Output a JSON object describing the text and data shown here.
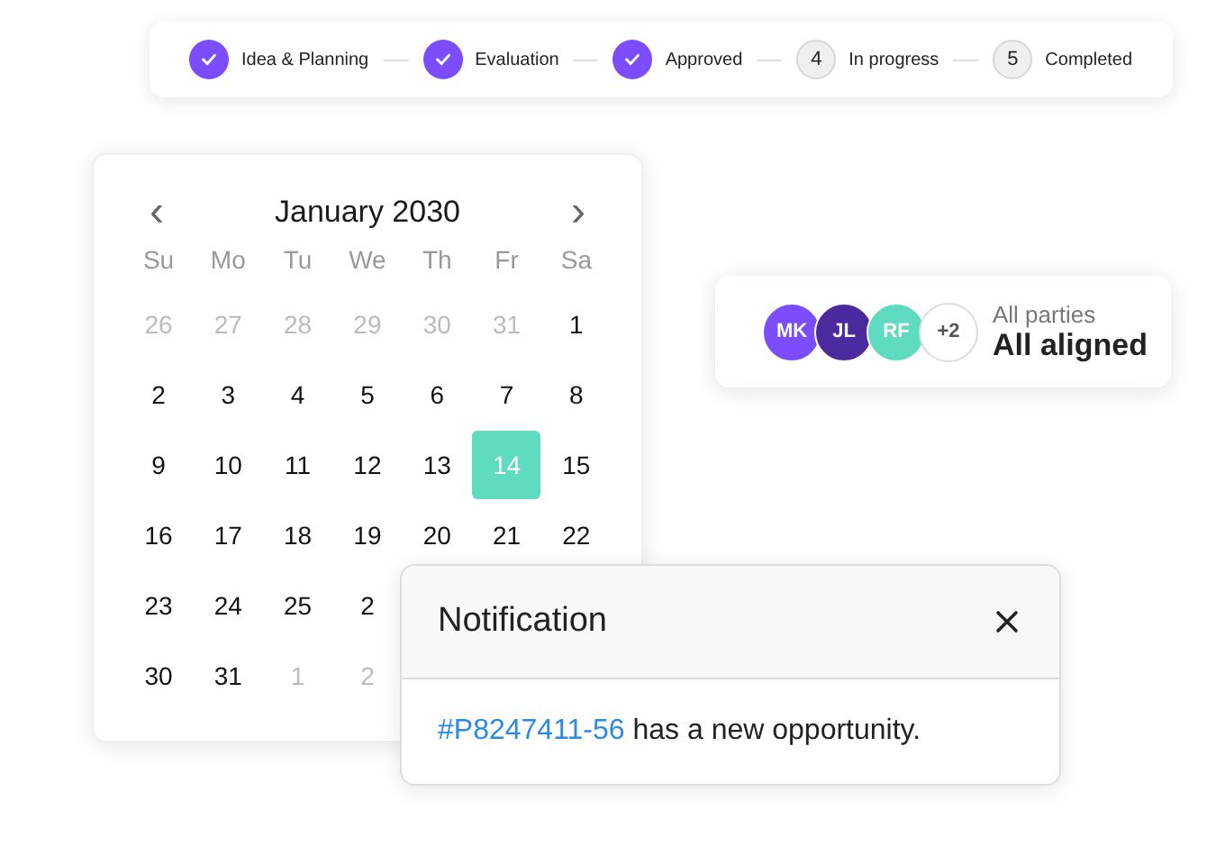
{
  "stepper": {
    "steps": [
      {
        "label": "Idea & Planning",
        "done": true
      },
      {
        "label": "Evaluation",
        "done": true
      },
      {
        "label": "Approved",
        "done": true
      },
      {
        "label": "In progress",
        "done": false,
        "number": "4"
      },
      {
        "label": "Completed",
        "done": false,
        "number": "5"
      }
    ]
  },
  "calendar": {
    "prev": "‹",
    "next": "›",
    "month": "January 2030",
    "weekdays": [
      "Su",
      "Mo",
      "Tu",
      "We",
      "Th",
      "Fr",
      "Sa"
    ],
    "weeks": [
      [
        {
          "day": "26",
          "outside": true,
          "selected": false
        },
        {
          "day": "27",
          "outside": true,
          "selected": false
        },
        {
          "day": "28",
          "outside": true,
          "selected": false
        },
        {
          "day": "29",
          "outside": true,
          "selected": false
        },
        {
          "day": "30",
          "outside": true,
          "selected": false
        },
        {
          "day": "31",
          "outside": true,
          "selected": false
        },
        {
          "day": "1",
          "outside": false,
          "selected": false
        }
      ],
      [
        {
          "day": "2",
          "outside": false,
          "selected": false
        },
        {
          "day": "3",
          "outside": false,
          "selected": false
        },
        {
          "day": "4",
          "outside": false,
          "selected": false
        },
        {
          "day": "5",
          "outside": false,
          "selected": false
        },
        {
          "day": "6",
          "outside": false,
          "selected": false
        },
        {
          "day": "7",
          "outside": false,
          "selected": false
        },
        {
          "day": "8",
          "outside": false,
          "selected": false
        }
      ],
      [
        {
          "day": "9",
          "outside": false,
          "selected": false
        },
        {
          "day": "10",
          "outside": false,
          "selected": false
        },
        {
          "day": "11",
          "outside": false,
          "selected": false
        },
        {
          "day": "12",
          "outside": false,
          "selected": false
        },
        {
          "day": "13",
          "outside": false,
          "selected": false
        },
        {
          "day": "14",
          "outside": false,
          "selected": true
        },
        {
          "day": "15",
          "outside": false,
          "selected": false
        }
      ],
      [
        {
          "day": "16",
          "outside": false,
          "selected": false
        },
        {
          "day": "17",
          "outside": false,
          "selected": false
        },
        {
          "day": "18",
          "outside": false,
          "selected": false
        },
        {
          "day": "19",
          "outside": false,
          "selected": false
        },
        {
          "day": "20",
          "outside": false,
          "selected": false
        },
        {
          "day": "21",
          "outside": false,
          "selected": false
        },
        {
          "day": "22",
          "outside": false,
          "selected": false
        }
      ],
      [
        {
          "day": "23",
          "outside": false,
          "selected": false
        },
        {
          "day": "24",
          "outside": false,
          "selected": false
        },
        {
          "day": "25",
          "outside": false,
          "selected": false
        },
        {
          "day": "2",
          "outside": false,
          "selected": false
        }
      ],
      [
        {
          "day": "30",
          "outside": false,
          "selected": false
        },
        {
          "day": "31",
          "outside": false,
          "selected": false
        },
        {
          "day": "1",
          "outside": true,
          "selected": false
        },
        {
          "day": "2",
          "outside": true,
          "selected": false
        }
      ]
    ]
  },
  "parties": {
    "avatars": [
      {
        "initials": "MK",
        "color": "#7c4dff"
      },
      {
        "initials": "JL",
        "color": "#4b2a9e"
      },
      {
        "initials": "RF",
        "color": "#5fdcc0"
      }
    ],
    "more": "+2",
    "caption": "All parties",
    "status": "All aligned"
  },
  "notification": {
    "title": "Notification",
    "link": "#P8247411-56",
    "text": "has a new opportunity."
  }
}
